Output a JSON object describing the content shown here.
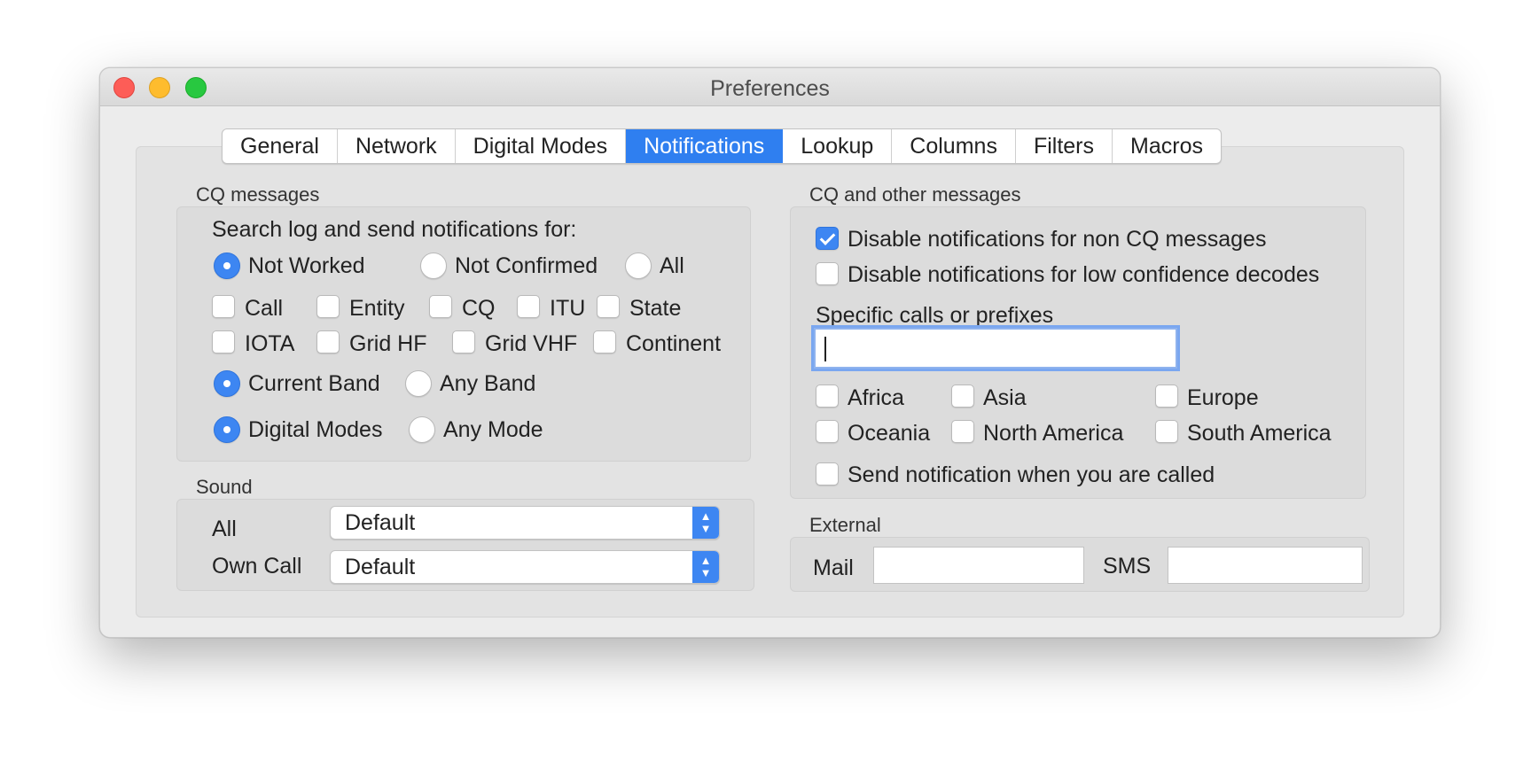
{
  "window": {
    "title": "Preferences"
  },
  "tabs": [
    "General",
    "Network",
    "Digital Modes",
    "Notifications",
    "Lookup",
    "Columns",
    "Filters",
    "Macros"
  ],
  "active_tab": "Notifications",
  "cq_messages": {
    "title": "CQ messages",
    "search_label": "Search log and send notifications for:",
    "worked_options": [
      {
        "label": "Not Worked",
        "selected": true
      },
      {
        "label": "Not Confirmed",
        "selected": false
      },
      {
        "label": "All",
        "selected": false
      }
    ],
    "checks_row1": [
      "Call",
      "Entity",
      "CQ",
      "ITU",
      "State"
    ],
    "checks_row2": [
      "IOTA",
      "Grid HF",
      "Grid VHF",
      "Continent"
    ],
    "band_options": [
      {
        "label": "Current Band",
        "selected": true
      },
      {
        "label": "Any Band",
        "selected": false
      }
    ],
    "mode_options": [
      {
        "label": "Digital Modes",
        "selected": true
      },
      {
        "label": "Any Mode",
        "selected": false
      }
    ]
  },
  "sound": {
    "title": "Sound",
    "all_label": "All",
    "all_value": "Default",
    "own_call_label": "Own Call",
    "own_call_value": "Default"
  },
  "other_messages": {
    "title": "CQ and other messages",
    "disable_non_cq": {
      "label": "Disable notifications for non CQ messages",
      "checked": true
    },
    "disable_low_conf": {
      "label": "Disable notifications for low confidence decodes",
      "checked": false
    },
    "specific_label": "Specific calls or prefixes",
    "specific_value": "",
    "continents_row1": [
      "Africa",
      "Asia",
      "Europe"
    ],
    "continents_row2": [
      "Oceania",
      "North America",
      "South America"
    ],
    "send_when_called": {
      "label": "Send notification when you are called",
      "checked": false
    }
  },
  "external": {
    "title": "External",
    "mail_label": "Mail",
    "mail_value": "",
    "sms_label": "SMS",
    "sms_value": ""
  }
}
